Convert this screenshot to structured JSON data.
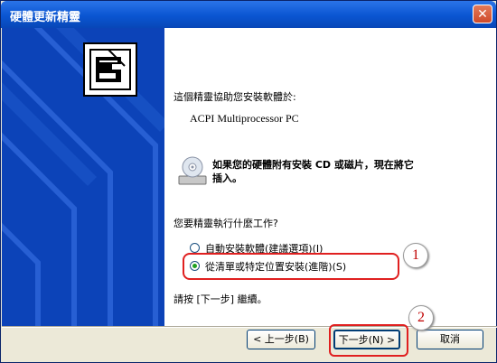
{
  "window": {
    "title": "硬體更新精靈"
  },
  "intro": {
    "line": "這個精靈協助您安裝軟體於:",
    "product": "ACPI Multiprocessor PC"
  },
  "cd_notice": {
    "line1": "如果您的硬體附有安裝 CD 或磁片，現在將它",
    "line2": "插入。"
  },
  "question": "您要精靈執行什麼工作?",
  "options": [
    {
      "label": "自動安裝軟體(建議選項)(I)",
      "selected": false
    },
    {
      "label": "從清單或特定位置安裝(進階)(S)",
      "selected": true
    }
  ],
  "instruction": "請按 [下一步] 繼續。",
  "buttons": {
    "back": "< 上一步(B)",
    "next": "下一步(N) >",
    "cancel": "取消"
  },
  "annotations": {
    "badge1": "1",
    "badge2": "2"
  },
  "colors": {
    "titlebar": "#0a55d2",
    "left_panel": "#0c43b8",
    "highlight": "#e02020"
  }
}
